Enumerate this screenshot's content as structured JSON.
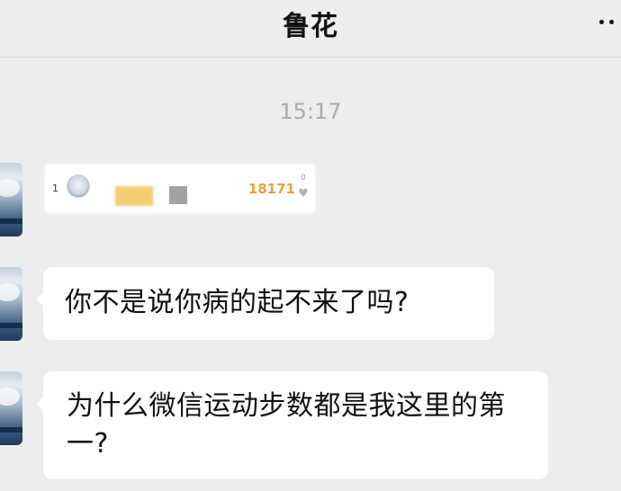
{
  "header": {
    "title": "鲁花",
    "more_icon": "more-dots-icon"
  },
  "timestamp": "15:17",
  "rank_card": {
    "rank": "1",
    "steps": "18171",
    "likes": "0",
    "heart_icon": "heart-icon"
  },
  "messages": [
    {
      "text": "你不是说你病的起不来了吗?"
    },
    {
      "text": "为什么微信运动步数都是我这里的第一?"
    }
  ],
  "colors": {
    "background": "#ededed",
    "bubble": "#ffffff",
    "steps": "#e9a23f",
    "timestamp": "#a9a9a9"
  }
}
